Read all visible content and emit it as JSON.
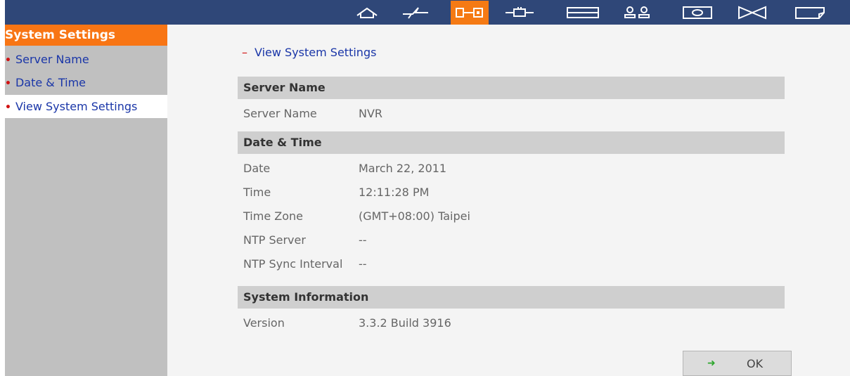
{
  "toolbar": {
    "icons": [
      {
        "name": "home-icon",
        "active": false
      },
      {
        "name": "quick-config-icon",
        "active": false
      },
      {
        "name": "system-settings-icon",
        "active": true
      },
      {
        "name": "network-icon",
        "active": false
      },
      {
        "name": "device-config-icon",
        "active": false
      },
      {
        "name": "user-management-icon",
        "active": false
      },
      {
        "name": "camera-settings-icon",
        "active": false
      },
      {
        "name": "system-tools-icon",
        "active": false
      },
      {
        "name": "logs-statistics-icon",
        "active": false
      }
    ],
    "colors": {
      "bar": "#2f4778",
      "active": "#f57a14"
    }
  },
  "sidebar": {
    "header": "System Settings",
    "items": [
      {
        "label": "Server Name",
        "selected": false
      },
      {
        "label": "Date & Time",
        "selected": false
      },
      {
        "label": "View System Settings",
        "selected": true
      }
    ]
  },
  "main": {
    "breadcrumb": "View System Settings",
    "sections": [
      {
        "title": "Server Name",
        "rows": [
          {
            "label": "Server Name",
            "value": "NVR"
          }
        ]
      },
      {
        "title": "Date & Time",
        "rows": [
          {
            "label": "Date",
            "value": "March 22, 2011"
          },
          {
            "label": "Time",
            "value": "12:11:28 PM"
          },
          {
            "label": "Time Zone",
            "value": "(GMT+08:00) Taipei"
          },
          {
            "label": "NTP Server",
            "value": "--"
          },
          {
            "label": "NTP Sync Interval",
            "value": "--"
          }
        ]
      },
      {
        "title": "System Information",
        "rows": [
          {
            "label": "Version",
            "value": "3.3.2 Build 3916"
          }
        ]
      }
    ],
    "ok_label": "OK"
  }
}
